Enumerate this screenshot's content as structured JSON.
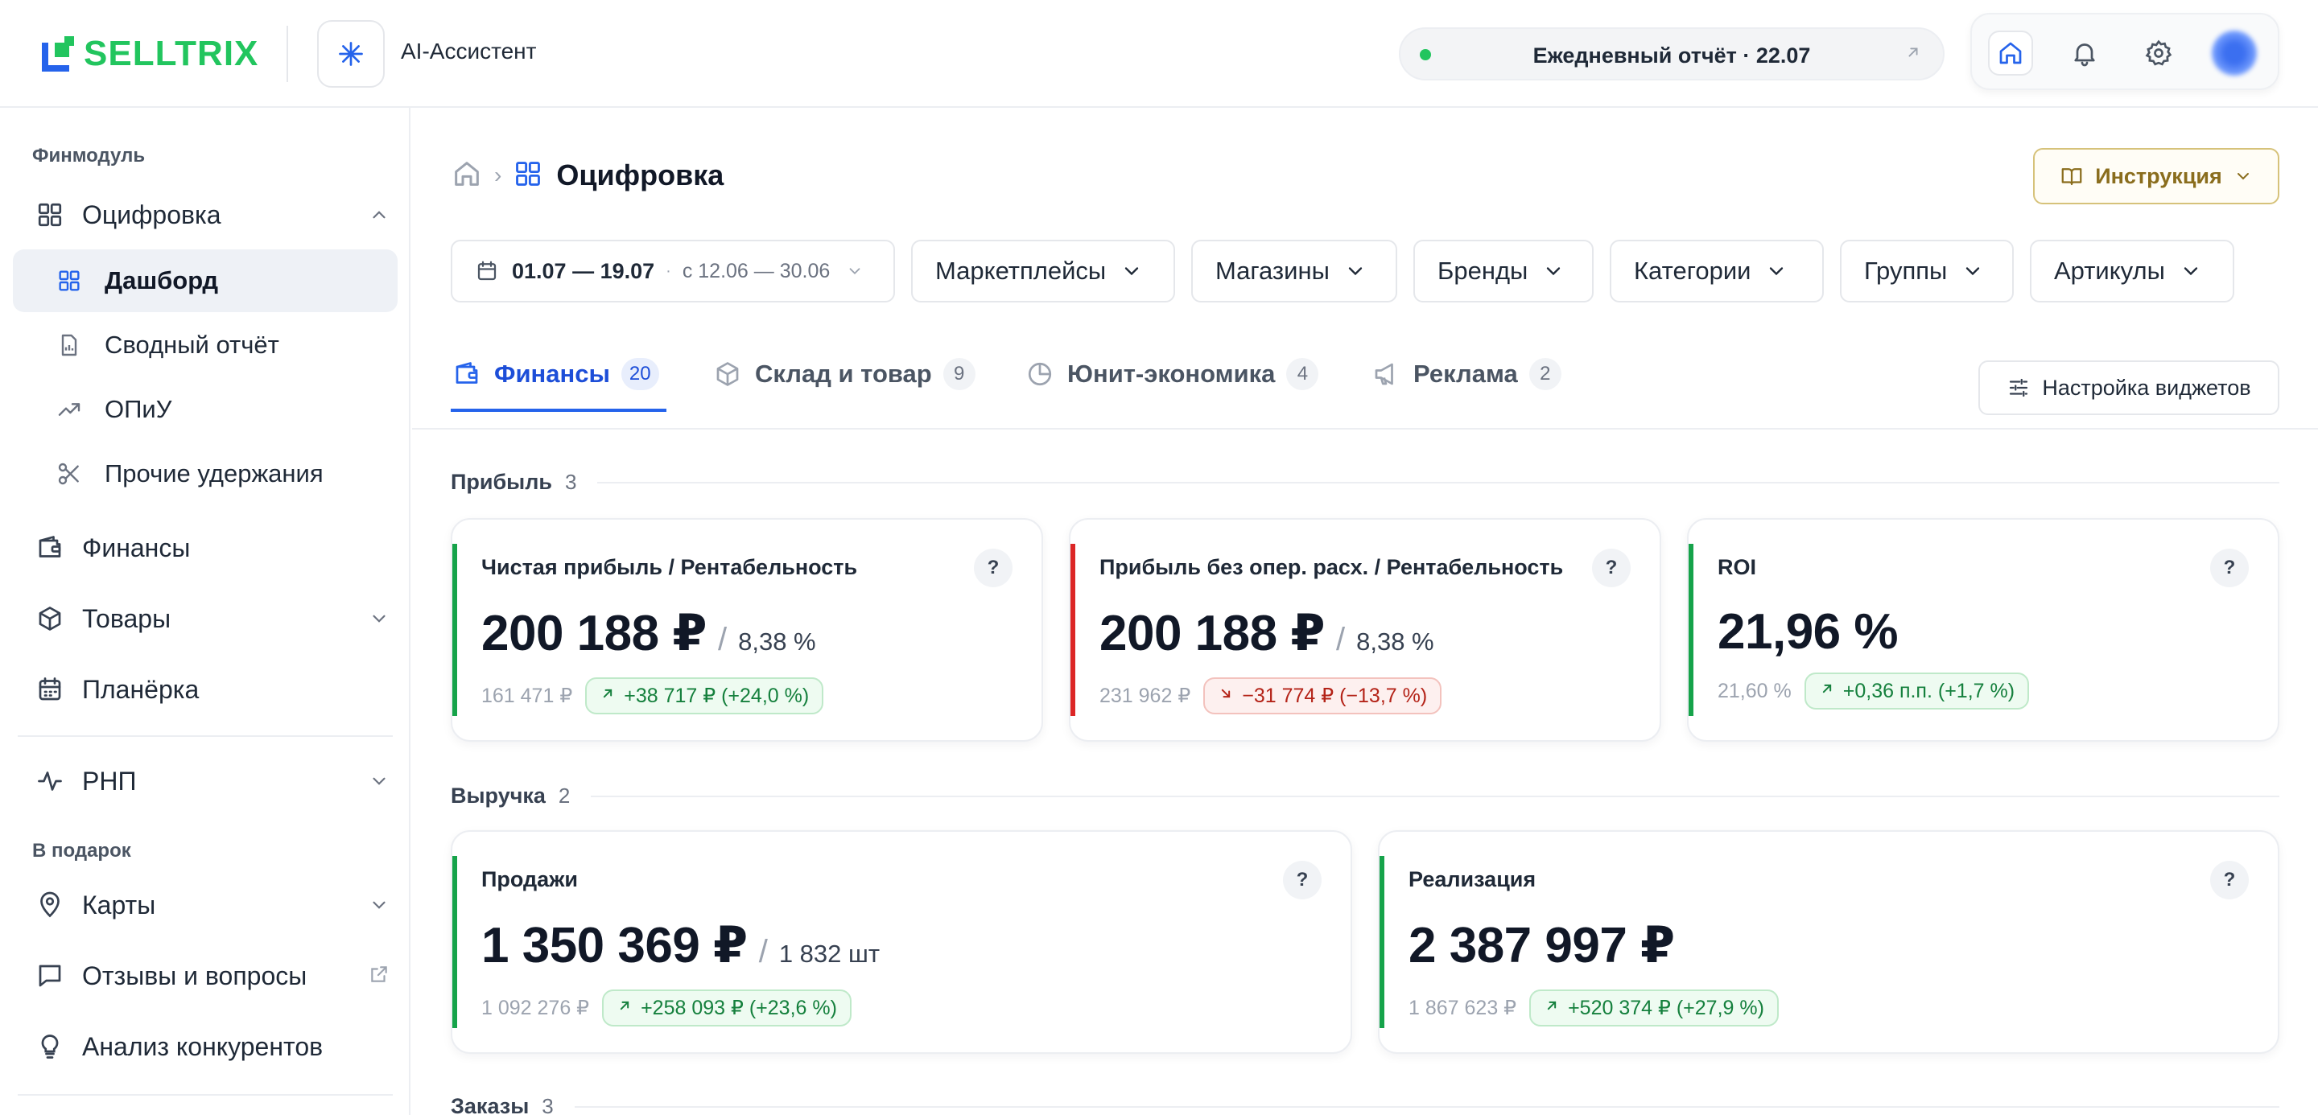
{
  "header": {
    "logo_text": "SELLTRIX",
    "ai_label": "AI-Ассистент",
    "report_label": "Ежедневный отчёт · 22.07"
  },
  "sidebar": {
    "section1": "Финмодуль",
    "ocifrovka": "Оцифровка",
    "sub": [
      "Дашборд",
      "Сводный отчёт",
      "ОПиУ",
      "Прочие удержания"
    ],
    "finance": "Финансы",
    "goods": "Товары",
    "planerka": "Планёрка",
    "rnp": "РНП",
    "section2": "В подарок",
    "maps": "Карты",
    "reviews": "Отзывы и вопросы",
    "competitors": "Анализ конкурентов"
  },
  "page": {
    "title": "Оцифровка",
    "instruction_label": "Инструкция",
    "date_range": "01.07 — 19.07",
    "compare_range": "с 12.06 — 30.06",
    "filters": [
      "Маркетплейсы",
      "Магазины",
      "Бренды",
      "Категории",
      "Группы",
      "Артикулы"
    ],
    "widget_settings": "Настройка виджетов"
  },
  "tabs": [
    {
      "label": "Финансы",
      "count": "20"
    },
    {
      "label": "Склад и товар",
      "count": "9"
    },
    {
      "label": "Юнит-экономика",
      "count": "4"
    },
    {
      "label": "Реклама",
      "count": "2"
    }
  ],
  "groups": {
    "profit": {
      "name": "Прибыль",
      "count": "3"
    },
    "revenue": {
      "name": "Выручка",
      "count": "2"
    },
    "orders": {
      "name": "Заказы",
      "count": "3"
    }
  },
  "cards": {
    "net_profit": {
      "title": "Чистая прибыль / Рентабельность",
      "value": "200 188 ₽",
      "sub": "8,38 %",
      "prev": "161 471 ₽",
      "delta": "+38 717 ₽ (+24,0 %)"
    },
    "op_profit": {
      "title": "Прибыль без опер. расх. / Рентабельность",
      "value": "200 188 ₽",
      "sub": "8,38 %",
      "prev": "231 962 ₽",
      "delta": "−31 774 ₽ (−13,7 %)"
    },
    "roi": {
      "title": "ROI",
      "value": "21,96 %",
      "prev": "21,60 %",
      "delta": "+0,36 п.п. (+1,7 %)"
    },
    "sales": {
      "title": "Продажи",
      "value": "1 350 369 ₽",
      "sub": "1 832 шт",
      "prev": "1 092 276 ₽",
      "delta": "+258 093 ₽ (+23,6 %)"
    },
    "realization": {
      "title": "Реализация",
      "value": "2 387 997 ₽",
      "prev": "1 867 623 ₽",
      "delta": "+520 374 ₽ (+27,9 %)"
    }
  },
  "q_mark": "?",
  "colors": {
    "accent_blue": "#2563eb",
    "positive": "#16a34a",
    "negative": "#dc2626",
    "brand_green": "#22c55e"
  }
}
